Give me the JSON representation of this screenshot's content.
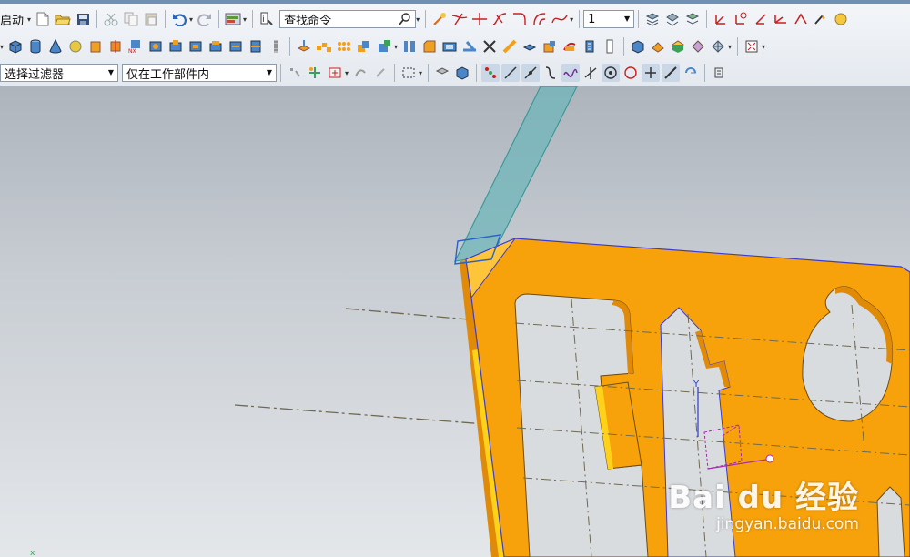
{
  "toolbar": {
    "start_menu": "启动",
    "search_placeholder": "查找命令",
    "layer_value": "1"
  },
  "selection_bar": {
    "filter_value": "选择过滤器",
    "scope_value": "仅在工作部件内"
  },
  "watermark": {
    "logo": "Bai du 经验",
    "url": "jingyan.baidu.com"
  },
  "colors": {
    "part_face": "#f7a20a",
    "part_side": "#e08a08",
    "part_edge_highlight": "#ffd21a",
    "sketch_plane": "#6fb6b9",
    "sketch_outline": "#3a9a98",
    "datum_line": "#6e6a52",
    "edge_blue": "#3b3bd0"
  },
  "icons": [
    "new-file-icon",
    "open-folder-icon",
    "save-icon",
    "cut-icon",
    "copy-icon",
    "paste-icon",
    "undo-icon",
    "redo-icon",
    "command-finder-icon",
    "search-icon",
    "block-icon",
    "cylinder-icon",
    "cone-icon",
    "sphere-icon",
    "wcs-axis-icon"
  ]
}
